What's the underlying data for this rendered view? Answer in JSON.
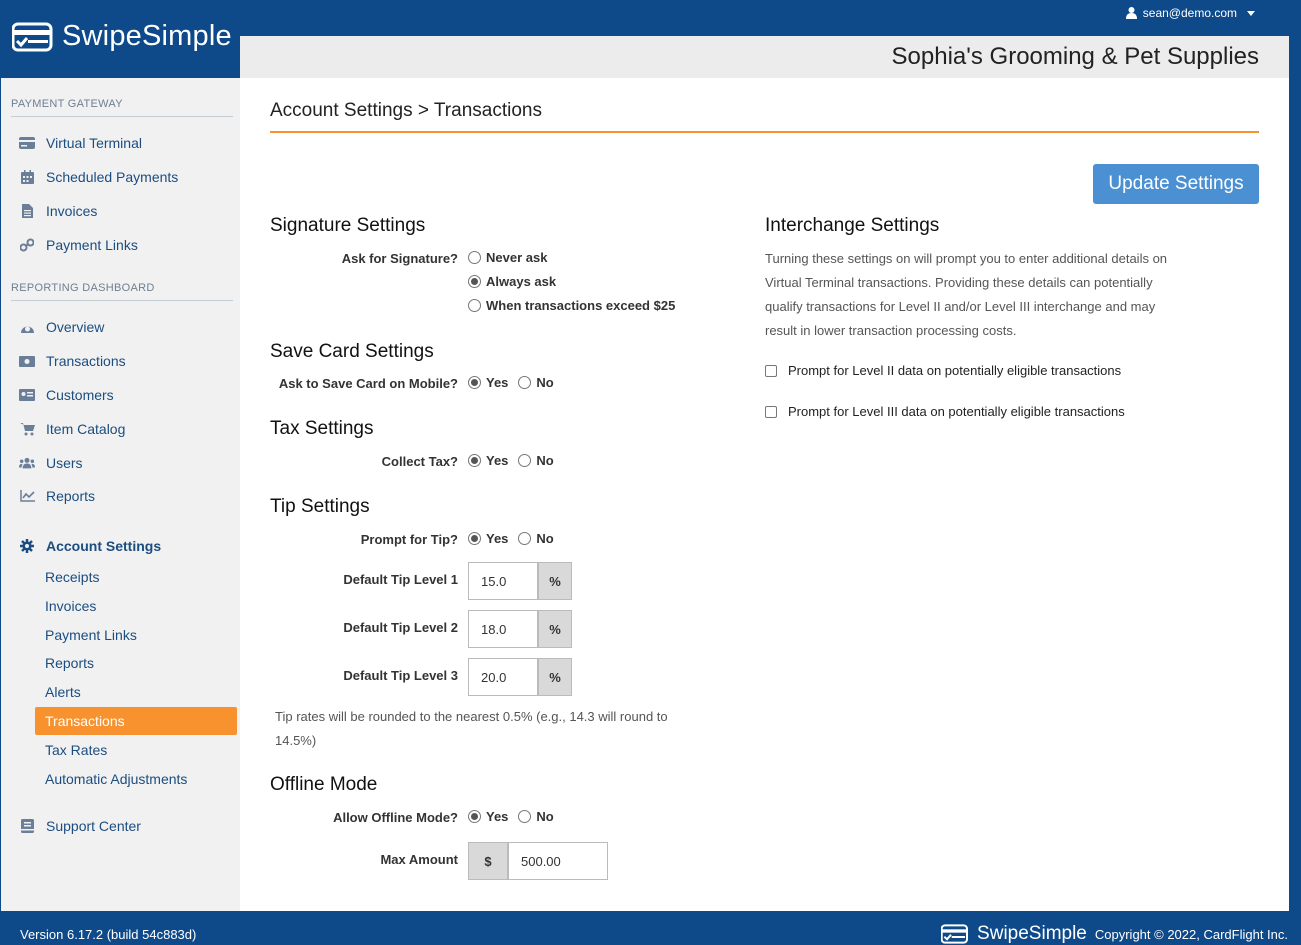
{
  "header": {
    "brand": "SwipeSimple",
    "user_email": "sean@demo.com",
    "business_name": "Sophia's Grooming & Pet Supplies"
  },
  "sidebar": {
    "section_gateway": "PAYMENT GATEWAY",
    "gateway_items": [
      {
        "label": "Virtual Terminal",
        "icon": "credit-card-icon"
      },
      {
        "label": "Scheduled Payments",
        "icon": "calendar-icon"
      },
      {
        "label": "Invoices",
        "icon": "document-icon"
      },
      {
        "label": "Payment Links",
        "icon": "link-icon"
      }
    ],
    "section_reporting": "REPORTING DASHBOARD",
    "reporting_items": [
      {
        "label": "Overview",
        "icon": "dashboard-icon"
      },
      {
        "label": "Transactions",
        "icon": "money-icon"
      },
      {
        "label": "Customers",
        "icon": "id-card-icon"
      },
      {
        "label": "Item Catalog",
        "icon": "cart-icon"
      },
      {
        "label": "Users",
        "icon": "users-icon"
      },
      {
        "label": "Reports",
        "icon": "line-chart-icon"
      }
    ],
    "account_settings": "Account Settings",
    "account_sub": [
      "Receipts",
      "Invoices",
      "Payment Links",
      "Reports",
      "Alerts",
      "Transactions",
      "Tax Rates",
      "Automatic Adjustments"
    ],
    "active_sub": "Transactions",
    "support": "Support Center"
  },
  "page": {
    "breadcrumb": "Account Settings > Transactions",
    "update_button": "Update Settings"
  },
  "signature": {
    "title": "Signature Settings",
    "label": "Ask for Signature?",
    "options": [
      "Never ask",
      "Always ask",
      "When transactions exceed $25"
    ],
    "selected": "Always ask"
  },
  "save_card": {
    "title": "Save Card Settings",
    "label": "Ask to Save Card on Mobile?",
    "yes": "Yes",
    "no": "No",
    "selected": "Yes"
  },
  "tax": {
    "title": "Tax Settings",
    "label": "Collect Tax?",
    "yes": "Yes",
    "no": "No",
    "selected": "Yes"
  },
  "tip": {
    "title": "Tip Settings",
    "label": "Prompt for Tip?",
    "yes": "Yes",
    "no": "No",
    "selected": "Yes",
    "level1_label": "Default Tip Level 1",
    "level1_value": "15.0",
    "level2_label": "Default Tip Level 2",
    "level2_value": "18.0",
    "level3_label": "Default Tip Level 3",
    "level3_value": "20.0",
    "unit": "%",
    "help_line1": "Tip rates will be rounded to the nearest 0.5% (e.g., 14.3 will round to",
    "help_line2": "14.5%)"
  },
  "offline": {
    "title": "Offline Mode",
    "label": "Allow Offline Mode?",
    "yes": "Yes",
    "no": "No",
    "selected": "Yes",
    "max_label": "Max Amount",
    "currency": "$",
    "max_value": "500.00"
  },
  "interchange": {
    "title": "Interchange Settings",
    "desc_lines": [
      "Turning these settings on will prompt you to enter additional details on",
      "Virtual Terminal transactions. Providing these details can potentially",
      "qualify transactions for Level II and/or Level III interchange and may",
      "result in lower transaction processing costs."
    ],
    "level2": "Prompt for Level II data on potentially eligible transactions",
    "level3": "Prompt for Level III data on potentially eligible transactions"
  },
  "footer": {
    "version": "Version 6.17.2 (build 54c883d)",
    "brand": "SwipeSimple",
    "copyright": "Copyright © 2022, CardFlight Inc."
  }
}
